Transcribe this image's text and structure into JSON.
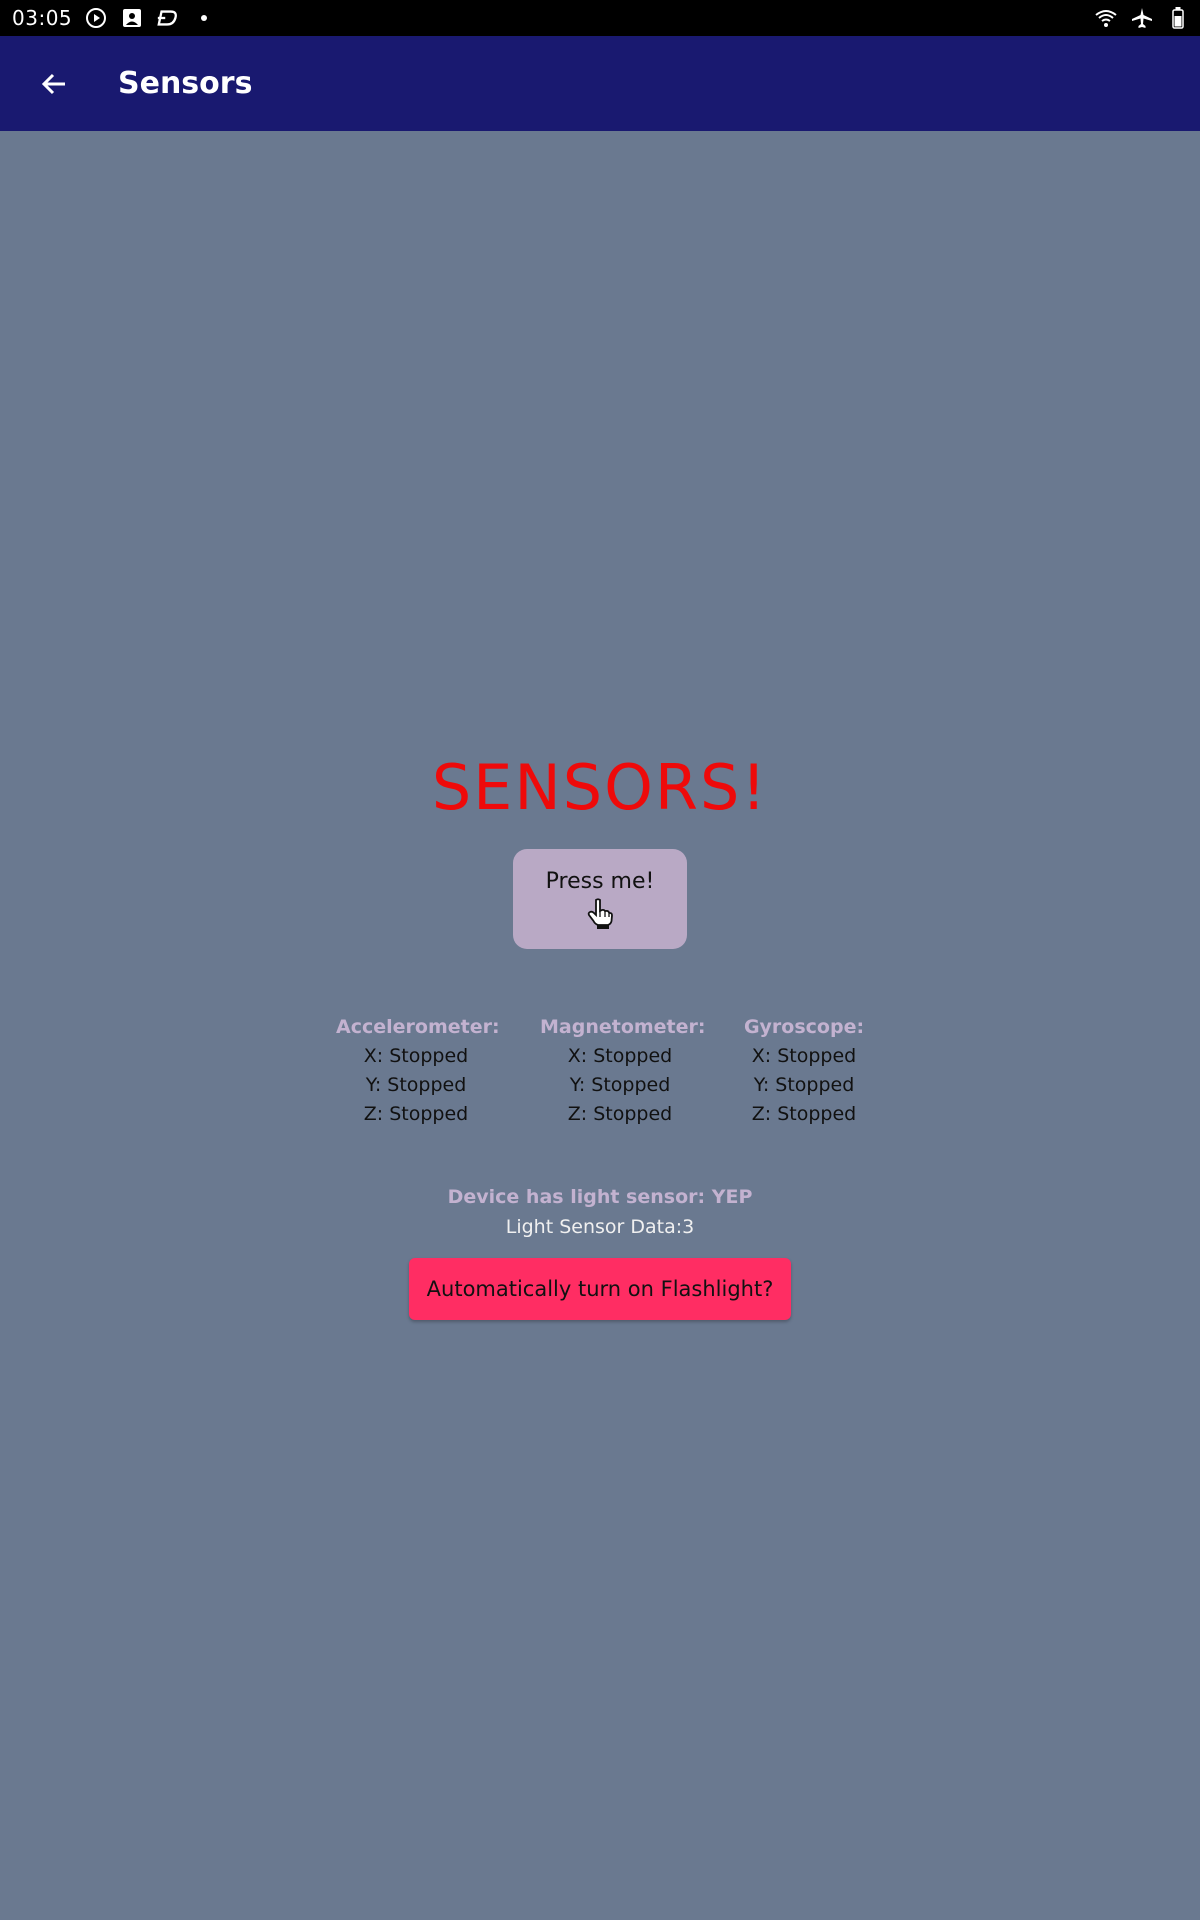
{
  "status_bar": {
    "time": "03:05",
    "icons": [
      "play-circle-icon",
      "image-icon",
      "d-logo-icon",
      "dot-icon",
      "wifi-icon",
      "airplane-icon",
      "battery-icon"
    ]
  },
  "app_bar": {
    "title": "Sensors",
    "back_icon": "arrow-back-icon"
  },
  "main": {
    "heading": "SENSORS!",
    "press_button_label": "Press me!",
    "press_button_icon": "pointing-hand-icon",
    "sensors": [
      {
        "name": "Accelerometer:",
        "x": "X: Stopped",
        "y": "Y: Stopped",
        "z": "Z: Stopped"
      },
      {
        "name": "Magnetometer:",
        "x": "X: Stopped",
        "y": "Y: Stopped",
        "z": "Z: Stopped"
      },
      {
        "name": "Gyroscope:",
        "x": "X: Stopped",
        "y": "Y: Stopped",
        "z": "Z: Stopped"
      }
    ],
    "light_sensor_present": "Device has light sensor: YEP",
    "light_sensor_data": "Light Sensor Data:3",
    "flashlight_button_label": "Automatically turn on Flashlight?"
  },
  "colors": {
    "background": "#6a7990",
    "app_bar": "#191970",
    "heading": "#ee0a0a",
    "press_button": "#b9a9c5",
    "sensor_heading": "#c3b2d0",
    "flash_button": "#ff2d63"
  }
}
